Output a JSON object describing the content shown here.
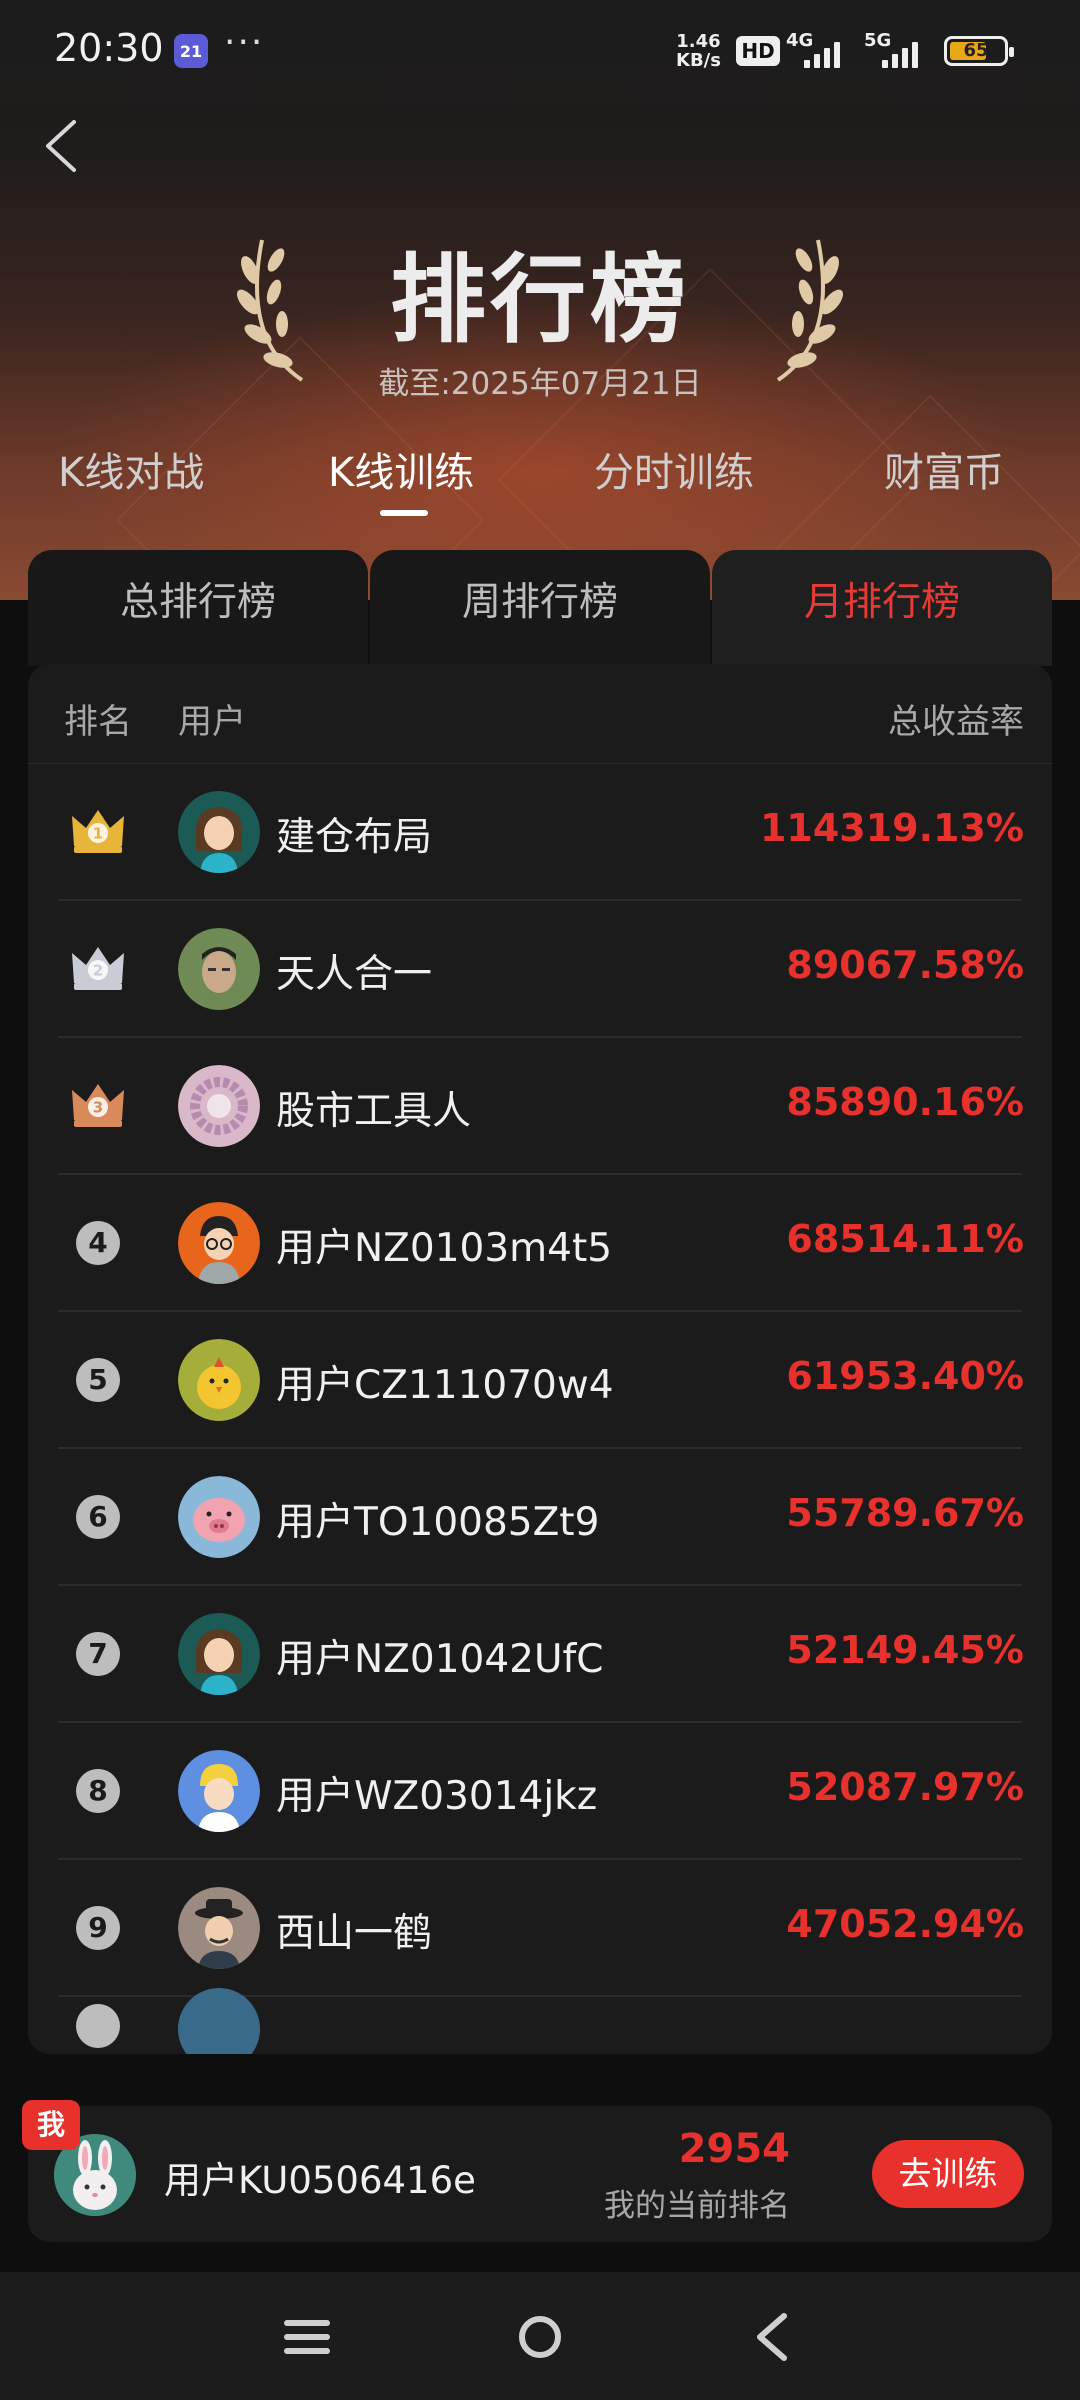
{
  "status_bar": {
    "time": "20:30",
    "calendar_day": "21",
    "more": "···",
    "speed_top": "1.46",
    "speed_unit": "KB/s",
    "hd_label": "HD",
    "network_4g": "4G",
    "network_5g": "5G",
    "battery": "65"
  },
  "header": {
    "title": "排行榜",
    "subtitle": "截至:2025年07月21日"
  },
  "category_tabs": [
    {
      "label": "K线对战",
      "active": false
    },
    {
      "label": "K线训练",
      "active": true
    },
    {
      "label": "分时训练",
      "active": false
    },
    {
      "label": "财富币",
      "active": false
    }
  ],
  "period_tabs": [
    {
      "label": "总排行榜",
      "active": false
    },
    {
      "label": "周排行榜",
      "active": false
    },
    {
      "label": "月排行榜",
      "active": true
    }
  ],
  "table": {
    "col_rank": "排名",
    "col_user": "用户",
    "col_rate": "总收益率",
    "rows": [
      {
        "rank": "1",
        "name": "建仓布局",
        "rate": "114319.13%",
        "avatar": "woman-avatar"
      },
      {
        "rank": "2",
        "name": "天人合一",
        "rate": "89067.58%",
        "avatar": "photo-avatar"
      },
      {
        "rank": "3",
        "name": "股市工具人",
        "rate": "85890.16%",
        "avatar": "bracelet-avatar"
      },
      {
        "rank": "4",
        "name": "用户NZ0103m4t5",
        "rate": "68514.11%",
        "avatar": "man-glasses-avatar"
      },
      {
        "rank": "5",
        "name": "用户CZ111070w4",
        "rate": "61953.40%",
        "avatar": "chick-avatar"
      },
      {
        "rank": "6",
        "name": "用户TO10085Zt9",
        "rate": "55789.67%",
        "avatar": "pig-avatar"
      },
      {
        "rank": "7",
        "name": "用户NZ01042UfC",
        "rate": "52149.45%",
        "avatar": "woman-avatar"
      },
      {
        "rank": "8",
        "name": "用户WZ03014jkz",
        "rate": "52087.97%",
        "avatar": "boy-avatar"
      },
      {
        "rank": "9",
        "name": "西山一鹤",
        "rate": "47052.94%",
        "avatar": "detective-avatar"
      }
    ]
  },
  "my_rank": {
    "badge": "我",
    "name": "用户KU0506416e",
    "rank": "2954",
    "rank_label": "我的当前排名",
    "button": "去训练"
  },
  "colors": {
    "accent_red": "#e8312c",
    "gold": "#e6b53a",
    "silver": "#c9cbd6",
    "bronze": "#d98a5a"
  }
}
